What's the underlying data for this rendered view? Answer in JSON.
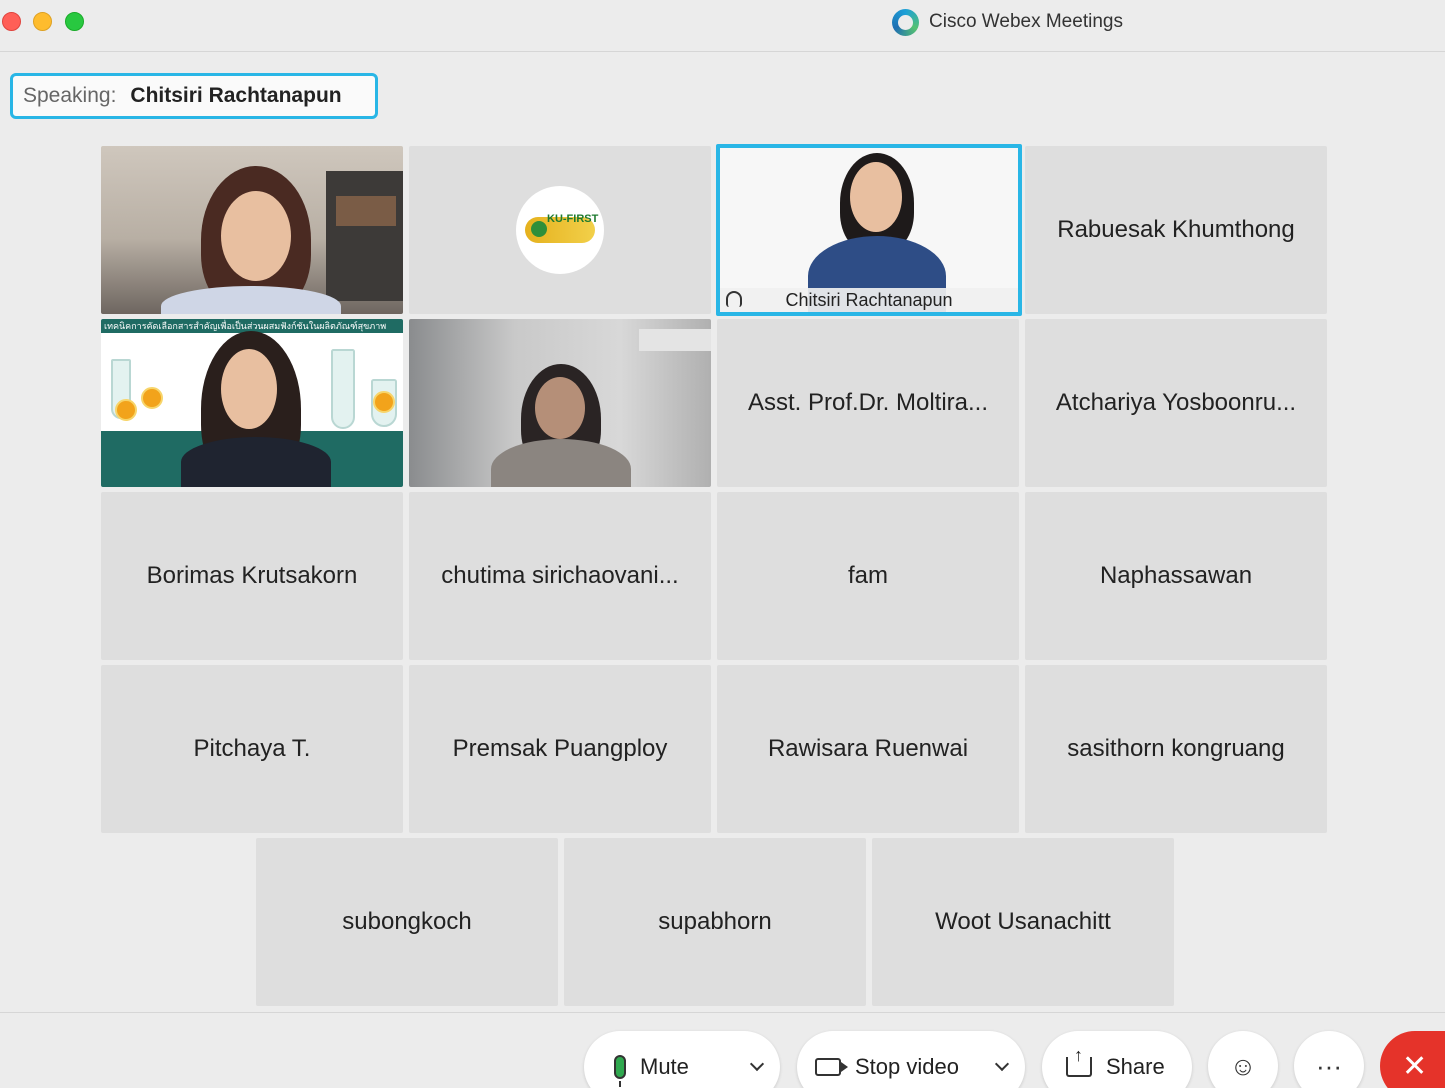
{
  "window": {
    "title": "Cisco Webex Meetings"
  },
  "speaking": {
    "label": "Speaking:",
    "name": "Chitsiri Rachtanapun"
  },
  "participants": [
    {
      "name": "",
      "type": "video"
    },
    {
      "name": "",
      "type": "logo",
      "logo_text": "KU-FIRST"
    },
    {
      "name": "Chitsiri Rachtanapun",
      "type": "video-active"
    },
    {
      "name": "Rabuesak Khumthong",
      "type": "name"
    },
    {
      "name": "",
      "type": "video-slide",
      "slide_banner": "เทคนิคการคัดเลือกสารสำคัญเพื่อเป็นส่วนผสมฟังก์ชันในผลิตภัณฑ์สุขภาพ"
    },
    {
      "name": "",
      "type": "video"
    },
    {
      "name": "Asst. Prof.Dr. Moltira...",
      "type": "name"
    },
    {
      "name": "Atchariya Yosboonru...",
      "type": "name"
    },
    {
      "name": "Borimas Krutsakorn",
      "type": "name"
    },
    {
      "name": "chutima sirichaovani...",
      "type": "name"
    },
    {
      "name": "fam",
      "type": "name"
    },
    {
      "name": "Naphassawan",
      "type": "name"
    },
    {
      "name": "Pitchaya T.",
      "type": "name"
    },
    {
      "name": "Premsak Puangploy",
      "type": "name"
    },
    {
      "name": "Rawisara Ruenwai",
      "type": "name"
    },
    {
      "name": "sasithorn kongruang",
      "type": "name"
    },
    {
      "name": "subongkoch",
      "type": "name"
    },
    {
      "name": "supabhorn",
      "type": "name"
    },
    {
      "name": "Woot Usanachitt",
      "type": "name"
    }
  ],
  "toolbar": {
    "mute_label": "Mute",
    "stop_video_label": "Stop video",
    "share_label": "Share",
    "more_label": "···",
    "end_label": "✕"
  },
  "colors": {
    "active_border": "#29b6e6",
    "mic_on": "#2fa84f",
    "end_call": "#e5332a"
  }
}
